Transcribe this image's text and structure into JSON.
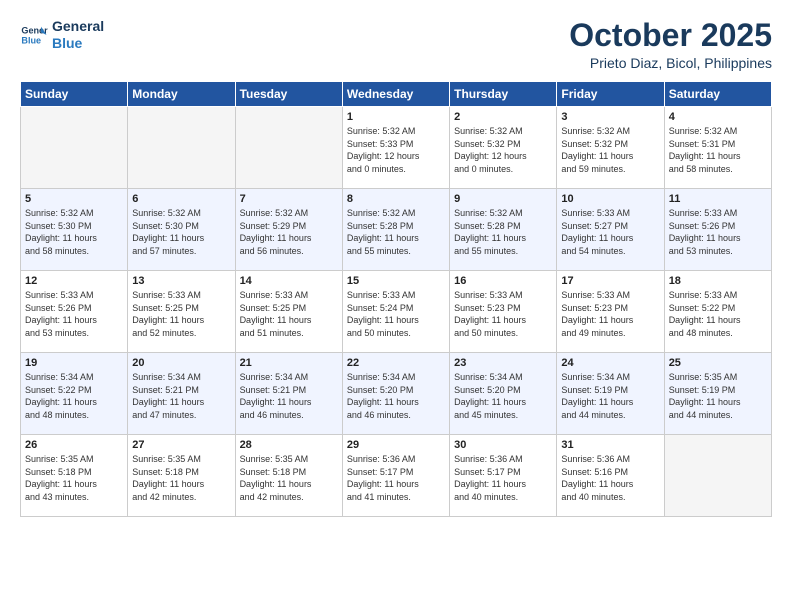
{
  "header": {
    "logo_line1": "General",
    "logo_line2": "Blue",
    "month": "October 2025",
    "location": "Prieto Diaz, Bicol, Philippines"
  },
  "weekdays": [
    "Sunday",
    "Monday",
    "Tuesday",
    "Wednesday",
    "Thursday",
    "Friday",
    "Saturday"
  ],
  "weeks": [
    [
      {
        "day": "",
        "info": ""
      },
      {
        "day": "",
        "info": ""
      },
      {
        "day": "",
        "info": ""
      },
      {
        "day": "1",
        "info": "Sunrise: 5:32 AM\nSunset: 5:33 PM\nDaylight: 12 hours\nand 0 minutes."
      },
      {
        "day": "2",
        "info": "Sunrise: 5:32 AM\nSunset: 5:32 PM\nDaylight: 12 hours\nand 0 minutes."
      },
      {
        "day": "3",
        "info": "Sunrise: 5:32 AM\nSunset: 5:32 PM\nDaylight: 11 hours\nand 59 minutes."
      },
      {
        "day": "4",
        "info": "Sunrise: 5:32 AM\nSunset: 5:31 PM\nDaylight: 11 hours\nand 58 minutes."
      }
    ],
    [
      {
        "day": "5",
        "info": "Sunrise: 5:32 AM\nSunset: 5:30 PM\nDaylight: 11 hours\nand 58 minutes."
      },
      {
        "day": "6",
        "info": "Sunrise: 5:32 AM\nSunset: 5:30 PM\nDaylight: 11 hours\nand 57 minutes."
      },
      {
        "day": "7",
        "info": "Sunrise: 5:32 AM\nSunset: 5:29 PM\nDaylight: 11 hours\nand 56 minutes."
      },
      {
        "day": "8",
        "info": "Sunrise: 5:32 AM\nSunset: 5:28 PM\nDaylight: 11 hours\nand 55 minutes."
      },
      {
        "day": "9",
        "info": "Sunrise: 5:32 AM\nSunset: 5:28 PM\nDaylight: 11 hours\nand 55 minutes."
      },
      {
        "day": "10",
        "info": "Sunrise: 5:33 AM\nSunset: 5:27 PM\nDaylight: 11 hours\nand 54 minutes."
      },
      {
        "day": "11",
        "info": "Sunrise: 5:33 AM\nSunset: 5:26 PM\nDaylight: 11 hours\nand 53 minutes."
      }
    ],
    [
      {
        "day": "12",
        "info": "Sunrise: 5:33 AM\nSunset: 5:26 PM\nDaylight: 11 hours\nand 53 minutes."
      },
      {
        "day": "13",
        "info": "Sunrise: 5:33 AM\nSunset: 5:25 PM\nDaylight: 11 hours\nand 52 minutes."
      },
      {
        "day": "14",
        "info": "Sunrise: 5:33 AM\nSunset: 5:25 PM\nDaylight: 11 hours\nand 51 minutes."
      },
      {
        "day": "15",
        "info": "Sunrise: 5:33 AM\nSunset: 5:24 PM\nDaylight: 11 hours\nand 50 minutes."
      },
      {
        "day": "16",
        "info": "Sunrise: 5:33 AM\nSunset: 5:23 PM\nDaylight: 11 hours\nand 50 minutes."
      },
      {
        "day": "17",
        "info": "Sunrise: 5:33 AM\nSunset: 5:23 PM\nDaylight: 11 hours\nand 49 minutes."
      },
      {
        "day": "18",
        "info": "Sunrise: 5:33 AM\nSunset: 5:22 PM\nDaylight: 11 hours\nand 48 minutes."
      }
    ],
    [
      {
        "day": "19",
        "info": "Sunrise: 5:34 AM\nSunset: 5:22 PM\nDaylight: 11 hours\nand 48 minutes."
      },
      {
        "day": "20",
        "info": "Sunrise: 5:34 AM\nSunset: 5:21 PM\nDaylight: 11 hours\nand 47 minutes."
      },
      {
        "day": "21",
        "info": "Sunrise: 5:34 AM\nSunset: 5:21 PM\nDaylight: 11 hours\nand 46 minutes."
      },
      {
        "day": "22",
        "info": "Sunrise: 5:34 AM\nSunset: 5:20 PM\nDaylight: 11 hours\nand 46 minutes."
      },
      {
        "day": "23",
        "info": "Sunrise: 5:34 AM\nSunset: 5:20 PM\nDaylight: 11 hours\nand 45 minutes."
      },
      {
        "day": "24",
        "info": "Sunrise: 5:34 AM\nSunset: 5:19 PM\nDaylight: 11 hours\nand 44 minutes."
      },
      {
        "day": "25",
        "info": "Sunrise: 5:35 AM\nSunset: 5:19 PM\nDaylight: 11 hours\nand 44 minutes."
      }
    ],
    [
      {
        "day": "26",
        "info": "Sunrise: 5:35 AM\nSunset: 5:18 PM\nDaylight: 11 hours\nand 43 minutes."
      },
      {
        "day": "27",
        "info": "Sunrise: 5:35 AM\nSunset: 5:18 PM\nDaylight: 11 hours\nand 42 minutes."
      },
      {
        "day": "28",
        "info": "Sunrise: 5:35 AM\nSunset: 5:18 PM\nDaylight: 11 hours\nand 42 minutes."
      },
      {
        "day": "29",
        "info": "Sunrise: 5:36 AM\nSunset: 5:17 PM\nDaylight: 11 hours\nand 41 minutes."
      },
      {
        "day": "30",
        "info": "Sunrise: 5:36 AM\nSunset: 5:17 PM\nDaylight: 11 hours\nand 40 minutes."
      },
      {
        "day": "31",
        "info": "Sunrise: 5:36 AM\nSunset: 5:16 PM\nDaylight: 11 hours\nand 40 minutes."
      },
      {
        "day": "",
        "info": ""
      }
    ]
  ]
}
